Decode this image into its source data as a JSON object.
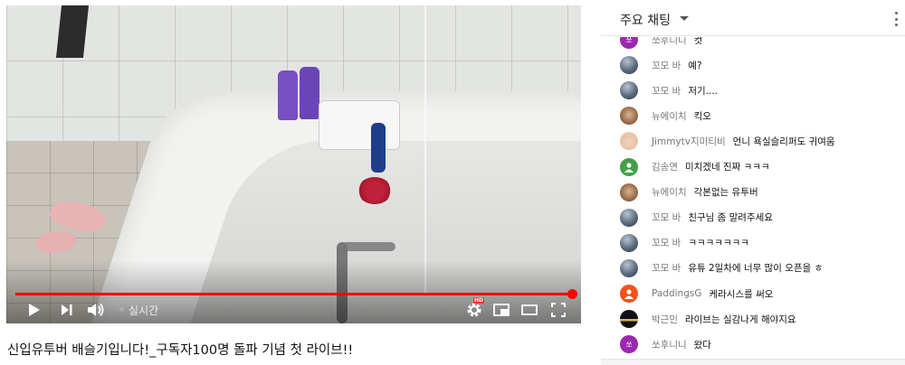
{
  "video": {
    "title": "신입유투버 배슬기입니다!_구독자100명 돌파 기념 첫 라이브!!",
    "live_label": "실시간",
    "progress": 1.0,
    "hd_badge": "HD"
  },
  "chat": {
    "header_title": "주요 채팅",
    "messages": [
      {
        "author": "쏘후니니",
        "text": "컷",
        "avatar_color": "#9c27b0",
        "avatar_letter": "쏘",
        "avatar_type": "letter"
      },
      {
        "author": "꼬모 바",
        "text": "예?",
        "avatar_color": "#5a6a7e",
        "avatar_type": "sphere"
      },
      {
        "author": "꼬모 바",
        "text": "저기....",
        "avatar_color": "#5a6a7e",
        "avatar_type": "sphere"
      },
      {
        "author": "뉴에이치",
        "text": "킥오",
        "avatar_color": "#a1785a",
        "avatar_type": "photo"
      },
      {
        "author": "Jimmytv지미티비",
        "text": "언니 욕실슬리퍼도 귀여움",
        "avatar_color": "#e7c2a6",
        "avatar_type": "face"
      },
      {
        "author": "김송연",
        "text": "미치겠네 진짜 ㅋㅋㅋ",
        "avatar_color": "#43a047",
        "avatar_type": "person"
      },
      {
        "author": "뉴에이치",
        "text": "각본없는 유투버",
        "avatar_color": "#a1785a",
        "avatar_type": "photo"
      },
      {
        "author": "꼬모 바",
        "text": "친구님 좀 말려주세요",
        "avatar_color": "#5a6a7e",
        "avatar_type": "sphere"
      },
      {
        "author": "꼬모 바",
        "text": "ㅋㅋㅋㅋㅋㅋㅋ",
        "avatar_color": "#5a6a7e",
        "avatar_type": "sphere"
      },
      {
        "author": "꼬모 바",
        "text": "유튜 2일차에 너무 많이 오픈을 ㅎ",
        "avatar_color": "#5a6a7e",
        "avatar_type": "sphere"
      },
      {
        "author": "PaddingsG",
        "text": "케라시스를 써오",
        "avatar_color": "#f4511e",
        "avatar_type": "person"
      },
      {
        "author": "박근민",
        "text": "라이브는 실감나게 해야지요",
        "avatar_color": "#111111",
        "avatar_type": "dark"
      },
      {
        "author": "쏘후니니",
        "text": "왔다",
        "avatar_color": "#9c27b0",
        "avatar_letter": "쏘",
        "avatar_type": "letter"
      }
    ]
  }
}
